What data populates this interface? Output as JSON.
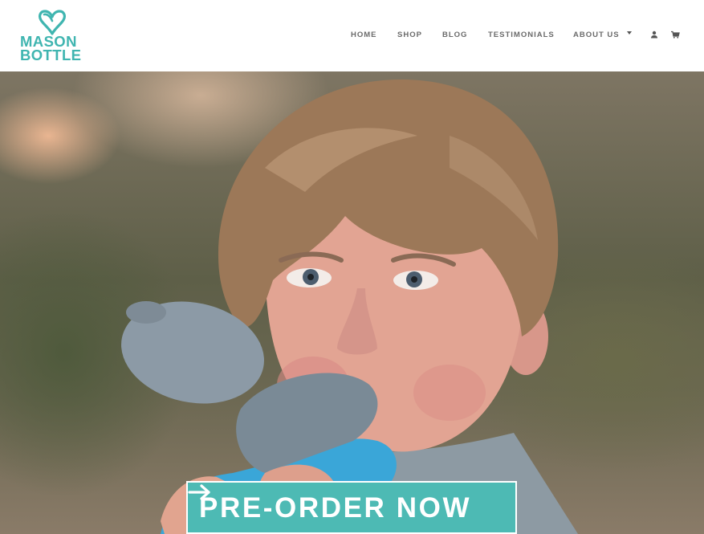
{
  "brand": {
    "line1": "MASON",
    "line2": "BOTTLE",
    "color": "#3fb5b0"
  },
  "nav": {
    "items": [
      {
        "label": "HOME"
      },
      {
        "label": "SHOP"
      },
      {
        "label": "BLOG"
      },
      {
        "label": "TESTIMONIALS"
      },
      {
        "label": "ABOUT US",
        "has_dropdown": true
      }
    ],
    "icons": [
      "user-icon",
      "cart-icon"
    ]
  },
  "hero": {
    "cta_label": "PRE-ORDER NOW",
    "cta_icon": "arrow-right-icon",
    "cta_color": "#4dbab4"
  }
}
